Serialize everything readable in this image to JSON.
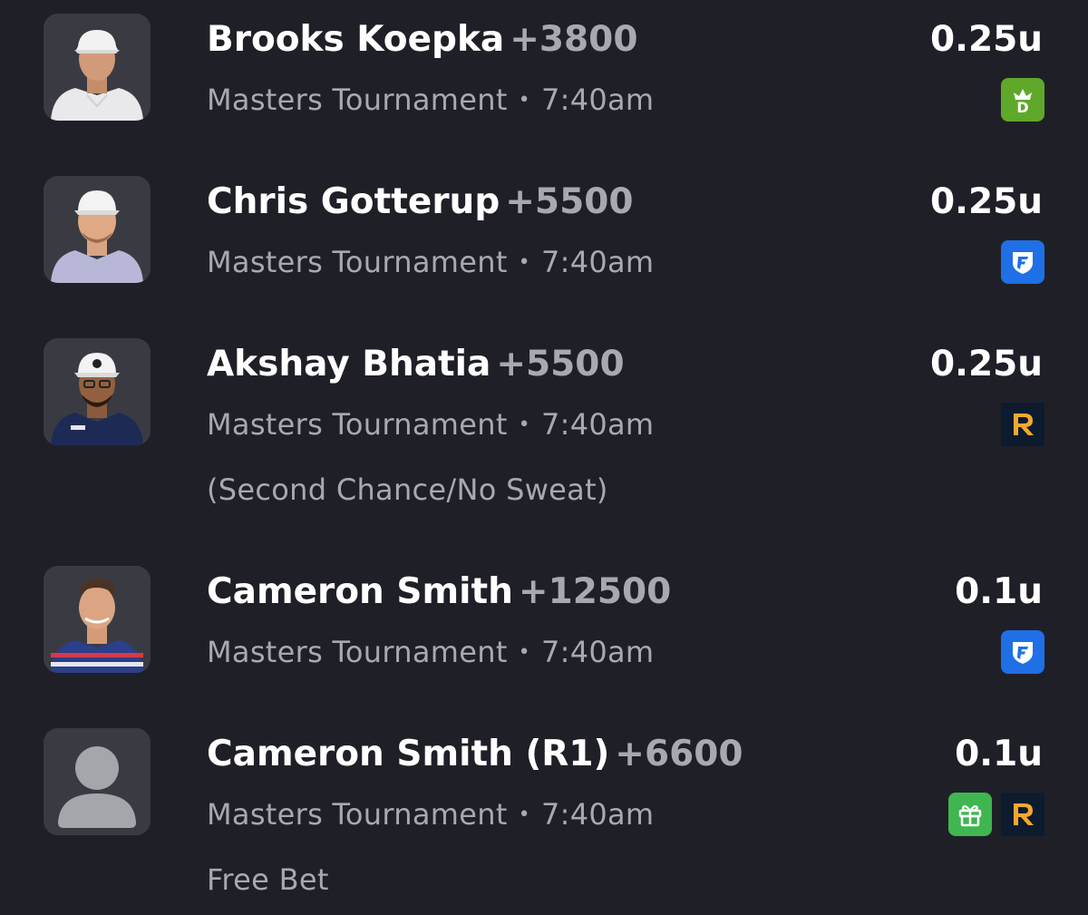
{
  "bets": [
    {
      "player": "Brooks Koepka",
      "odds": "+3800",
      "event": "Masters Tournament",
      "separator": "•",
      "time": "7:40am",
      "stake": "0.25u",
      "books": [
        {
          "icon": "draftkings-icon",
          "color": "#5fa829"
        }
      ],
      "avatar": "player-photo"
    },
    {
      "player": "Chris Gotterup",
      "odds": "+5500",
      "event": "Masters Tournament",
      "separator": "•",
      "time": "7:40am",
      "stake": "0.25u",
      "books": [
        {
          "icon": "fanduel-icon",
          "color": "#1f6fe6"
        }
      ],
      "avatar": "player-photo"
    },
    {
      "player": "Akshay Bhatia",
      "odds": "+5500",
      "event": "Masters Tournament",
      "separator": "•",
      "time": "7:40am",
      "note": "(Second Chance/No Sweat)",
      "stake": "0.25u",
      "books": [
        {
          "icon": "rebet-icon",
          "color": "#0d1b2e"
        }
      ],
      "avatar": "player-photo"
    },
    {
      "player": "Cameron Smith",
      "odds": "+12500",
      "event": "Masters Tournament",
      "separator": "•",
      "time": "7:40am",
      "stake": "0.1u",
      "books": [
        {
          "icon": "fanduel-icon",
          "color": "#1f6fe6"
        }
      ],
      "avatar": "player-photo"
    },
    {
      "player": "Cameron Smith (R1)",
      "odds": "+6600",
      "event": "Masters Tournament",
      "separator": "•",
      "time": "7:40am",
      "note": "Free Bet",
      "stake": "0.1u",
      "books": [
        {
          "icon": "gift-icon",
          "color": "#3fb650"
        },
        {
          "icon": "rebet-icon",
          "color": "#0d1b2e"
        }
      ],
      "avatar": "placeholder-person-icon"
    }
  ]
}
